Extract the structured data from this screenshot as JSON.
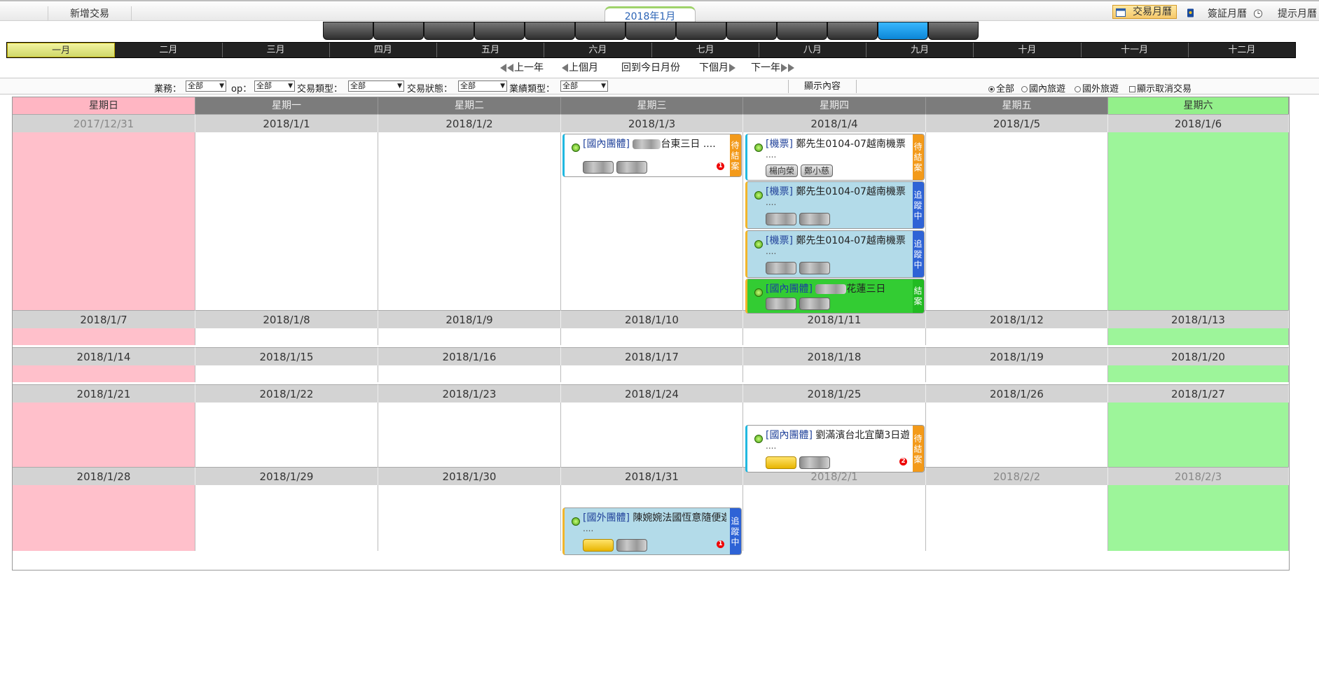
{
  "topbar": {
    "new_trade": "新增交易",
    "current_month": "2018年1月",
    "tabs": {
      "trade_calendar": "交易月曆",
      "visa_calendar": "簽証月曆",
      "reminder_calendar": "提示月曆"
    }
  },
  "months": [
    "一月",
    "二月",
    "三月",
    "四月",
    "五月",
    "六月",
    "七月",
    "八月",
    "九月",
    "十月",
    "十一月",
    "十二月"
  ],
  "nav": {
    "prev_year": "上一年",
    "prev_month": "上個月",
    "this_month": "回到今日月份",
    "next_month": "下個月",
    "next_year": "下一年"
  },
  "filters": {
    "business_label": "業務：",
    "business_value": "全部",
    "op_label": "op：",
    "op_value": "全部",
    "trade_type_label": "交易類型：",
    "trade_type_value": "全部",
    "trade_status_label": "交易狀態：",
    "trade_status_value": "全部",
    "perf_type_label": "業績類型：",
    "perf_type_value": "全部",
    "show_content": "顯示內容",
    "radio_all": "全部",
    "radio_domestic": "國內旅遊",
    "radio_overseas": "國外旅遊",
    "show_cancelled": "顯示取消交易"
  },
  "weekdays": [
    "星期日",
    "星期一",
    "星期二",
    "星期三",
    "星期四",
    "星期五",
    "星期六"
  ],
  "weeks": [
    [
      "2017/12/31",
      "2018/1/1",
      "2018/1/2",
      "2018/1/3",
      "2018/1/4",
      "2018/1/5",
      "2018/1/6"
    ],
    [
      "2018/1/7",
      "2018/1/8",
      "2018/1/9",
      "2018/1/10",
      "2018/1/11",
      "2018/1/12",
      "2018/1/13"
    ],
    [
      "2018/1/14",
      "2018/1/15",
      "2018/1/16",
      "2018/1/17",
      "2018/1/18",
      "2018/1/19",
      "2018/1/20"
    ],
    [
      "2018/1/21",
      "2018/1/22",
      "2018/1/23",
      "2018/1/24",
      "2018/1/25",
      "2018/1/26",
      "2018/1/27"
    ],
    [
      "2018/1/28",
      "2018/1/29",
      "2018/1/30",
      "2018/1/31",
      "2018/2/1",
      "2018/2/2",
      "2018/2/3"
    ]
  ],
  "events": {
    "e1": {
      "tag": "[國內團體]",
      "title": "台東三日 ....",
      "status": "待結案",
      "badge": "1"
    },
    "e2": {
      "tag": "[機票]",
      "title": "鄭先生0104-07越南機票",
      "dots": "....",
      "status": "待結案",
      "chip1": "楊向榮",
      "chip2": "鄭小慈"
    },
    "e3": {
      "tag": "[機票]",
      "title": "鄭先生0104-07越南機票",
      "dots": "....",
      "status": "追蹤中"
    },
    "e4": {
      "tag": "[機票]",
      "title": "鄭先生0104-07越南機票",
      "dots": "....",
      "status": "追蹤中"
    },
    "e5": {
      "tag": "[國內團體]",
      "title": "花蓮三日",
      "status": "結案"
    },
    "e6": {
      "tag": "[國內團體]",
      "title": "劉滿濱台北宜蘭3日遊",
      "dots": "....",
      "status": "待結案",
      "badge": "2"
    },
    "e7": {
      "tag": "[國外團體]",
      "title": "陳婉婉法國恆意隨便遊",
      "dots": "....",
      "status": "追蹤中",
      "badge": "1"
    }
  }
}
